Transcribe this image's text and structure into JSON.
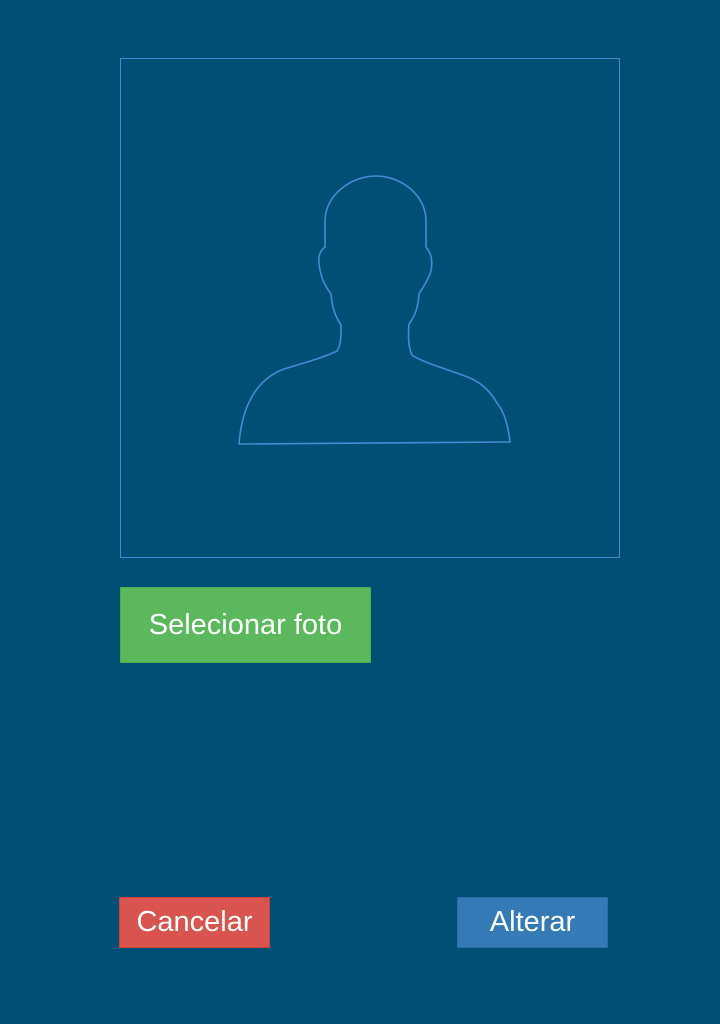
{
  "photo": {
    "placeholder_icon": "user-silhouette-icon",
    "frame_color": "#3d8fd6"
  },
  "actions": {
    "select_photo_label": "Selecionar foto",
    "cancel_label": "Cancelar",
    "change_label": "Alterar"
  },
  "colors": {
    "background": "#005075",
    "select_button": "#5cb85c",
    "cancel_button": "#d9534f",
    "change_button": "#337ab7"
  }
}
